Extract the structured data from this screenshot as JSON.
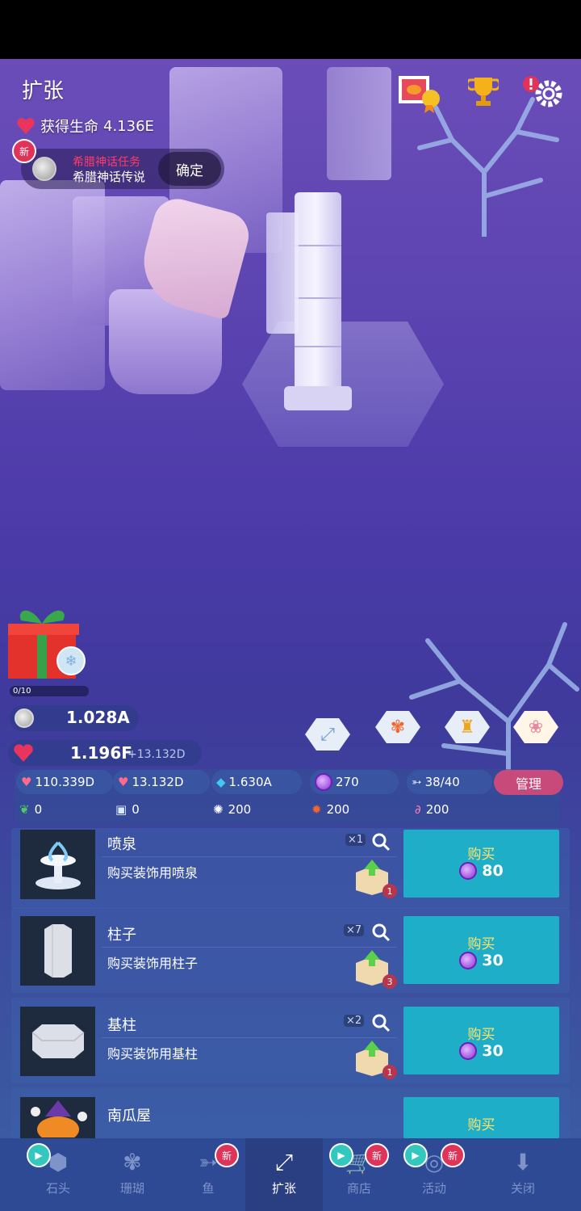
{
  "header": {
    "title": "扩张",
    "life_label": "获得生命",
    "life_value": "4.136E"
  },
  "quest": {
    "new_badge": "新",
    "name_red": "希腊神话任务",
    "name": "希腊神话传说",
    "confirm": "确定"
  },
  "gift": {
    "progress": "0/10"
  },
  "currency": {
    "coins": "1.028A",
    "life": "1.196F",
    "life_rate": "+13.132D"
  },
  "stats": {
    "tap": "110.339D",
    "life_per_sec": "13.132D",
    "diamond": "1.630A",
    "pearl": "270",
    "fish": "38/40",
    "manage": "管理",
    "seaweed": "0",
    "ice": "0",
    "urchin": "200",
    "crab": "200",
    "flamingo": "200"
  },
  "shop": [
    {
      "name": "喷泉",
      "desc": "购买装饰用喷泉",
      "owned": "×1",
      "box_count": "1",
      "buy": "购买",
      "price": "80"
    },
    {
      "name": "柱子",
      "desc": "购买装饰用柱子",
      "owned": "×7",
      "box_count": "3",
      "buy": "购买",
      "price": "30"
    },
    {
      "name": "基柱",
      "desc": "购买装饰用基柱",
      "owned": "×2",
      "box_count": "1",
      "buy": "购买",
      "price": "30"
    },
    {
      "name": "南瓜屋",
      "buy": "购买"
    }
  ],
  "nav": {
    "stone": "石头",
    "coral": "珊瑚",
    "fish": "鱼",
    "expand": "扩张",
    "shop": "商店",
    "events": "活动",
    "close": "关闭",
    "new_badge": "新"
  },
  "colors": {
    "buy_button": "#1eaec8",
    "manage_button": "#c84a7a",
    "new_badge": "#e0335a"
  }
}
